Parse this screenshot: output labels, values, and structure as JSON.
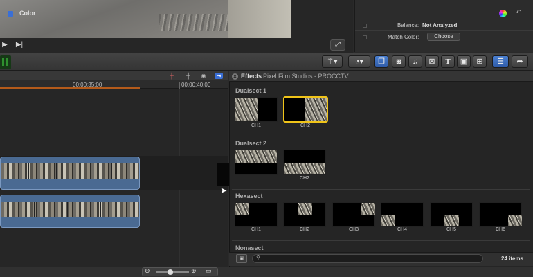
{
  "viewer": {
    "play_icon": "play-icon",
    "end_icon": "skip-to-end-icon",
    "fullscreen_icon": "fullscreen-icon"
  },
  "inspector": {
    "section": "Color",
    "balance_label": "Balance:",
    "balance_value": "Not Analyzed",
    "match_label": "Match Color:",
    "choose_button": "Choose"
  },
  "timeline": {
    "timecodes": [
      "00:00:35:00",
      "00:00:40:00"
    ]
  },
  "effects": {
    "title": "Effects",
    "path": "Pixel Film Studios - PROCCTV",
    "sections": [
      {
        "title": "Dualsect 1",
        "items": [
          "CH1",
          "CH2"
        ]
      },
      {
        "title": "Dualsect 2",
        "items": [
          "",
          "CH2"
        ]
      },
      {
        "title": "Hexasect",
        "items": [
          "CH1",
          "CH2",
          "CH3",
          "CH4",
          "CH5",
          "CH6"
        ]
      },
      {
        "title": "Nonasect",
        "items": []
      }
    ],
    "selected": "Dualsect 1 / CH2",
    "search_placeholder": "",
    "items_count": "24 items"
  },
  "colors": {
    "accent_blue": "#3a6fd6",
    "selection_yellow": "#f0c419",
    "clip_blue": "#4a6a92",
    "playhead_orange": "#b45a1a"
  }
}
